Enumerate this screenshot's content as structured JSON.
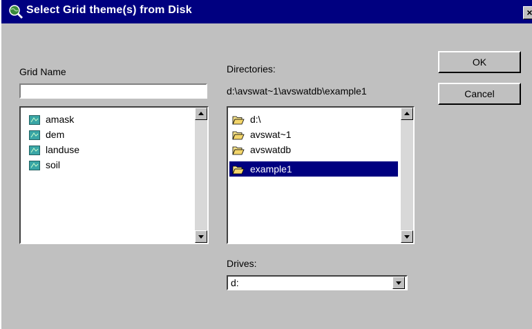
{
  "window": {
    "title": "Select Grid theme(s) from Disk",
    "close_symbol": "×"
  },
  "grid_name": {
    "label": "Grid Name",
    "input_value": "",
    "items": [
      "amask",
      "dem",
      "landuse",
      "soil"
    ],
    "item_icon": "grid-theme-icon"
  },
  "directories": {
    "label": "Directories:",
    "current_path": "d:\\avswat~1\\avswatdb\\example1",
    "items": [
      "d:\\",
      "avswat~1",
      "avswatdb",
      "example1"
    ],
    "selected": "example1",
    "item_icon": "folder-icon"
  },
  "drives": {
    "label": "Drives:",
    "selected": "d:"
  },
  "buttons": {
    "ok": "OK",
    "cancel": "Cancel"
  },
  "colors": {
    "title_bar": "#000080",
    "selection": "#000080",
    "dialog_bg": "#c0c0c0"
  }
}
